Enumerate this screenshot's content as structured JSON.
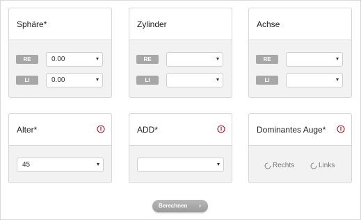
{
  "sphaere": {
    "title": "Sphäre*",
    "re_label": "RE",
    "li_label": "LI",
    "re_value": "0.00",
    "li_value": "0.00"
  },
  "zylinder": {
    "title": "Zylinder",
    "re_label": "RE",
    "li_label": "LI",
    "re_value": "",
    "li_value": ""
  },
  "achse": {
    "title": "Achse",
    "re_label": "RE",
    "li_label": "LI",
    "re_value": "",
    "li_value": ""
  },
  "alter": {
    "title": "Alter*",
    "value": "45",
    "icon": "info-icon"
  },
  "add": {
    "title": "ADD*",
    "value": "",
    "icon": "info-icon"
  },
  "dominantes_auge": {
    "title": "Dominantes Auge*",
    "icon": "info-icon",
    "options": [
      "Rechts",
      "Links"
    ]
  },
  "calculate_button": {
    "label": "Berechnen",
    "arrow": "›"
  },
  "colors": {
    "accent_info": "#a31a2a",
    "badge_gray": "#a7a7a7",
    "button_gray": "#a9a9a9"
  }
}
